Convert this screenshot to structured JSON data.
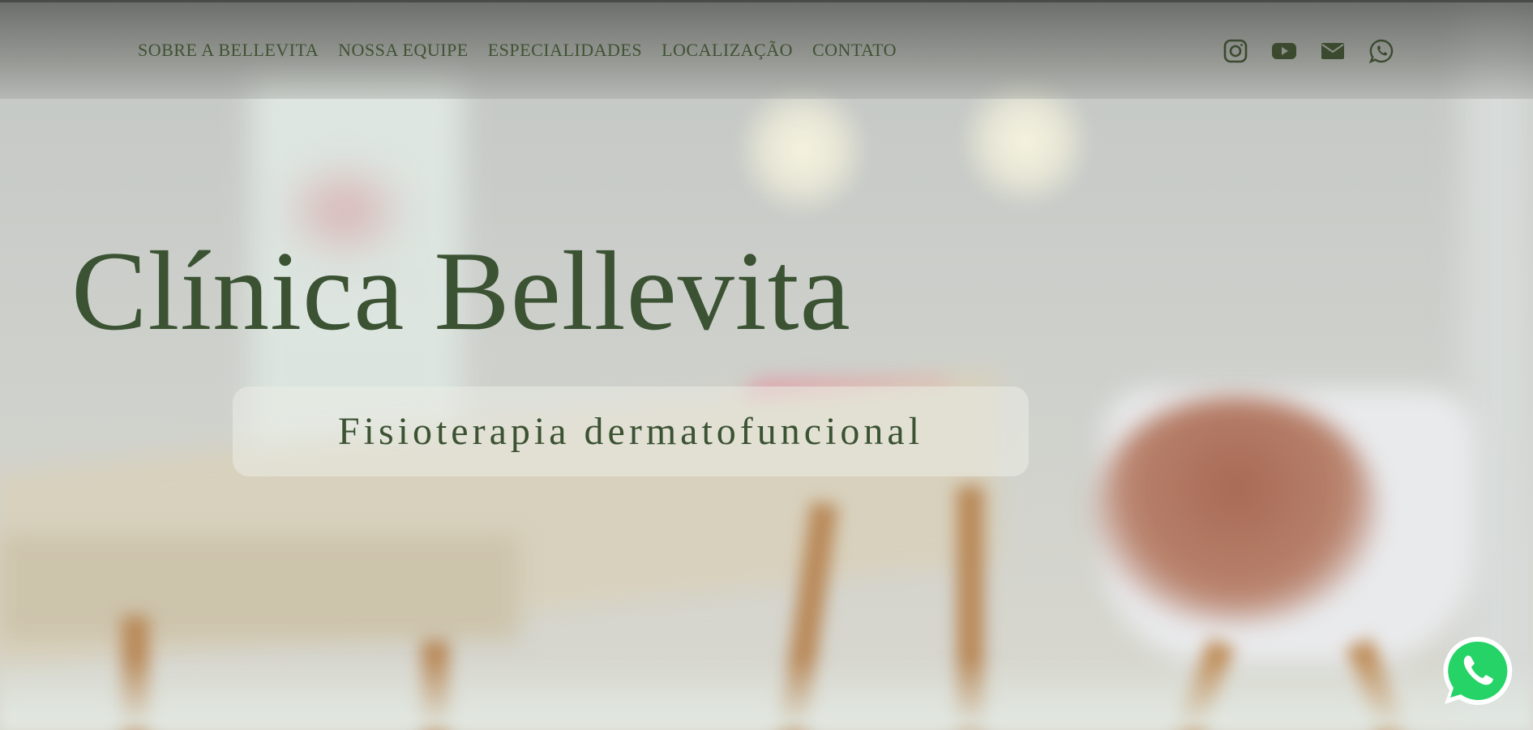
{
  "nav": {
    "items": [
      {
        "label": "SOBRE A BELLEVITA"
      },
      {
        "label": "NOSSA EQUIPE"
      },
      {
        "label": "ESPECIALIDADES"
      },
      {
        "label": "LOCALIZAÇÃO"
      },
      {
        "label": "CONTATO"
      }
    ]
  },
  "socials": {
    "icons": [
      "instagram-icon",
      "youtube-icon",
      "email-icon",
      "whatsapp-icon"
    ]
  },
  "hero": {
    "title": "Clínica Bellevita",
    "subtitle": "Fisioterapia dermatofuncional"
  },
  "floating_button": {
    "icon": "whatsapp-icon",
    "color": "#25d366"
  },
  "colors": {
    "brand_green": "#3b5233",
    "nav_bar": "#5a5c58"
  }
}
